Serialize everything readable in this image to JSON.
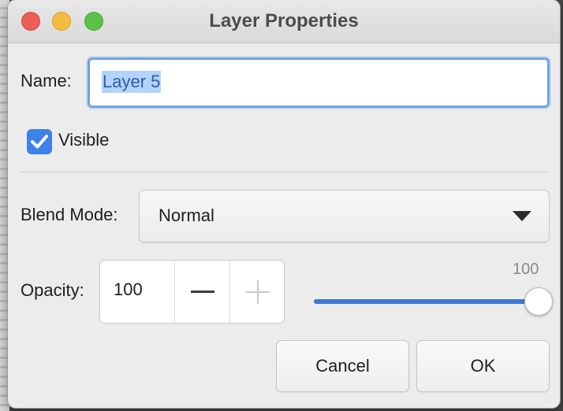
{
  "window": {
    "title": "Layer Properties"
  },
  "form": {
    "name_label": "Name:",
    "name_value": "Layer 5",
    "visible_label": "Visible",
    "visible_checked": true,
    "blend_mode_label": "Blend Mode:",
    "blend_mode_value": "Normal",
    "opacity_label": "Opacity:",
    "opacity_value": "100",
    "opacity_slider_max_label": "100",
    "opacity_fraction": 1.0
  },
  "buttons": {
    "cancel_label": "Cancel",
    "ok_label": "OK"
  },
  "icons": {
    "close": "close-traffic-light",
    "minimize": "minimize-traffic-light",
    "zoom": "zoom-traffic-light",
    "checkbox": "checkmark-icon",
    "dropdown": "triangle-down-icon",
    "minus": "minus-icon",
    "plus": "plus-icon"
  },
  "colors": {
    "accent": "#3d82e8",
    "selection": "#b3d3fc",
    "close": "#ec5f57",
    "minimize": "#f2bd3e",
    "zoom": "#5ac244"
  }
}
